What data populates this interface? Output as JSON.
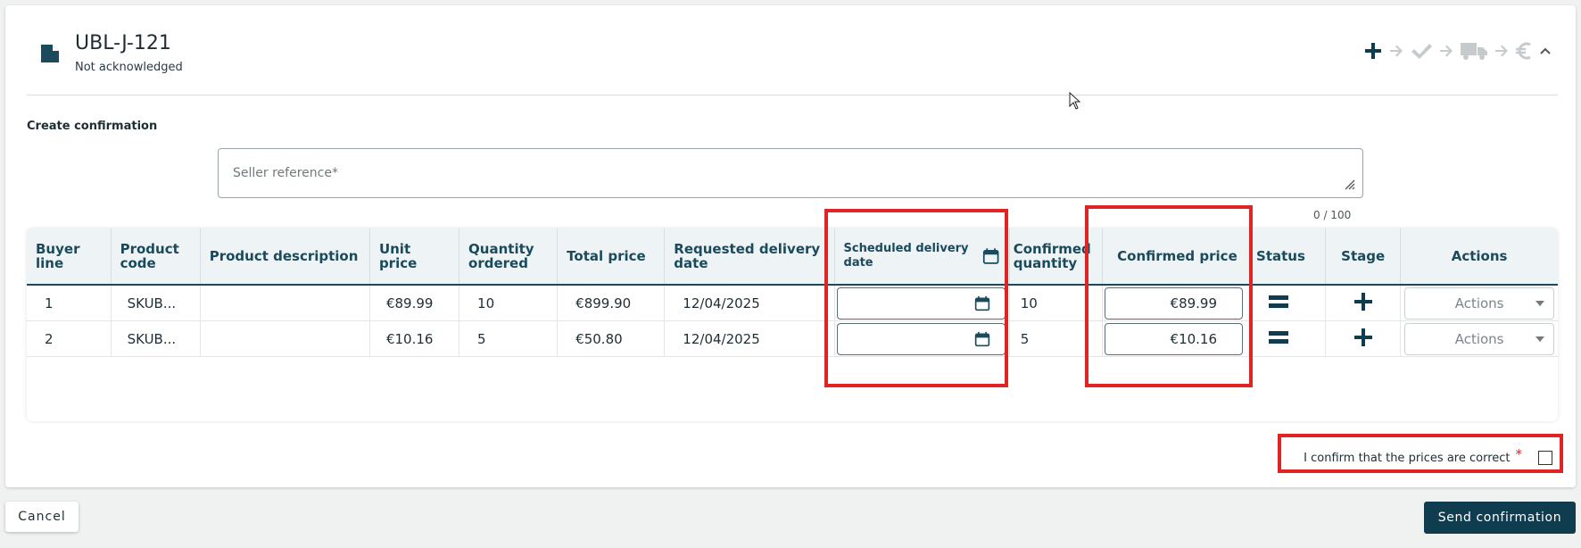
{
  "header": {
    "title": "UBL-J-121",
    "status": "Not acknowledged",
    "flow_icons": [
      "plus-icon",
      "arrow-right-icon",
      "check-icon",
      "arrow-right-icon",
      "truck-icon",
      "arrow-right-icon",
      "euro-icon",
      "chevron-up-icon"
    ]
  },
  "form": {
    "section_title": "Create confirmation",
    "seller_reference_placeholder": "Seller reference*",
    "seller_reference_value": "",
    "counter": "0 / 100"
  },
  "table": {
    "columns": [
      "Buyer line",
      "Product code",
      "Product description",
      "Unit price",
      "Quantity ordered",
      "Total price",
      "Requested delivery date",
      "Scheduled delivery date",
      "Confirmed quantity",
      "Confirmed price",
      "Status",
      "Stage",
      "Actions"
    ],
    "rows": [
      {
        "buyer_line": "1",
        "product_code": "SKUB...",
        "product_description": "",
        "unit_price": "€89.99",
        "quantity_ordered": "10",
        "total_price": "€899.90",
        "requested_delivery_date": "12/04/2025",
        "scheduled_delivery_date": "",
        "confirmed_quantity": "10",
        "confirmed_price": "€89.99",
        "status_icon": "equals-icon",
        "stage_icon": "plus-icon",
        "actions": "Actions"
      },
      {
        "buyer_line": "2",
        "product_code": "SKUB...",
        "product_description": "",
        "unit_price": "€10.16",
        "quantity_ordered": "5",
        "total_price": "€50.80",
        "requested_delivery_date": "12/04/2025",
        "scheduled_delivery_date": "",
        "confirmed_quantity": "5",
        "confirmed_price": "€10.16",
        "status_icon": "equals-icon",
        "stage_icon": "plus-icon",
        "actions": "Actions"
      }
    ]
  },
  "confirm": {
    "label": "I confirm that the prices are correct",
    "required_mark": "*",
    "checked": false
  },
  "buttons": {
    "cancel": "Cancel",
    "send": "Send confirmation"
  },
  "colors": {
    "primary": "#0f3d4f",
    "header_text": "#1a4a5c",
    "highlight": "#e02424",
    "disabled_icon": "#c5cacc"
  }
}
